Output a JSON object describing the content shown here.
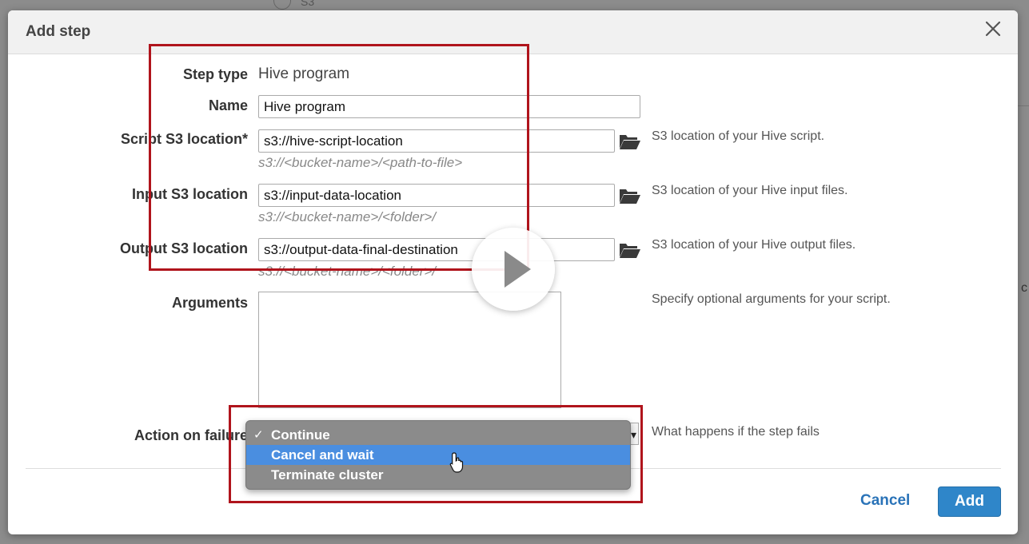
{
  "background": {
    "top_text": "S3"
  },
  "dialog": {
    "title": "Add step"
  },
  "form": {
    "step_type": {
      "label": "Step type",
      "value": "Hive program"
    },
    "name": {
      "label": "Name",
      "value": "Hive program"
    },
    "script_location": {
      "label": "Script S3 location*",
      "value": "s3://hive-script-location",
      "hint": "s3://<bucket-name>/<path-to-file>",
      "help": "S3 location of your Hive script."
    },
    "input_location": {
      "label": "Input S3 location",
      "value": "s3://input-data-location",
      "hint": "s3://<bucket-name>/<folder>/",
      "help": "S3 location of your Hive input files."
    },
    "output_location": {
      "label": "Output S3 location",
      "value": "s3://output-data-final-destination",
      "hint": "s3://<bucket-name>/<folder>/",
      "help": "S3 location of your Hive output files."
    },
    "arguments": {
      "label": "Arguments",
      "value": "",
      "help": "Specify optional arguments for your script."
    },
    "action_on_failure": {
      "label": "Action on failure",
      "help": "What happens if the step fails",
      "selected": "Continue",
      "options": [
        "Continue",
        "Cancel and wait",
        "Terminate cluster"
      ],
      "check_mark": "✓"
    }
  },
  "footer": {
    "cancel_label": "Cancel",
    "add_label": "Add"
  },
  "icons": {
    "close": "close-icon",
    "folder": "folder-icon",
    "play": "play-icon",
    "cursor": "hand-pointer-icon"
  },
  "colors": {
    "annotation_red": "#b0141c",
    "primary_button": "#2f86c9",
    "link": "#2a73b8",
    "menu_highlight": "#4a8ee0"
  }
}
